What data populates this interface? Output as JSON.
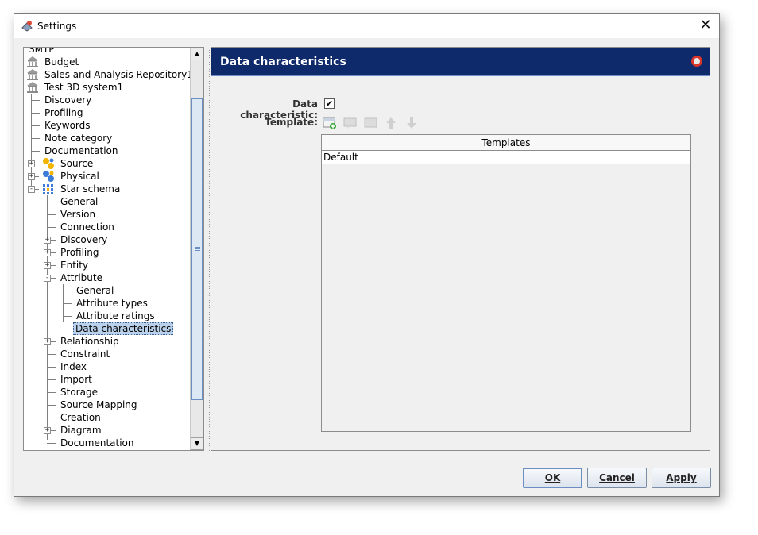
{
  "window": {
    "title": "Settings",
    "close_glyph": "✕"
  },
  "tree": {
    "items": [
      {
        "label": "SMTP"
      },
      {
        "label": "Budget",
        "icon": "bank-icon"
      },
      {
        "label": "Sales and Analysis Repository1",
        "icon": "bank-icon"
      },
      {
        "label": "Test 3D system1",
        "icon": "bank-icon"
      },
      {
        "label": "Discovery"
      },
      {
        "label": "Profiling"
      },
      {
        "label": "Keywords"
      },
      {
        "label": "Note category"
      },
      {
        "label": "Documentation"
      },
      {
        "label": "Source",
        "icon": "source-icon",
        "expander": "+"
      },
      {
        "label": "Physical",
        "icon": "physical-icon",
        "expander": "+"
      },
      {
        "label": "Star schema",
        "icon": "star-schema-icon",
        "expander": "-"
      },
      {
        "label": "General"
      },
      {
        "label": "Version"
      },
      {
        "label": "Connection"
      },
      {
        "label": "Discovery",
        "expander": "+"
      },
      {
        "label": "Profiling",
        "expander": "+"
      },
      {
        "label": "Entity",
        "expander": "+"
      },
      {
        "label": "Attribute",
        "expander": "-"
      },
      {
        "label": "General"
      },
      {
        "label": "Attribute types"
      },
      {
        "label": "Attribute ratings"
      },
      {
        "label": "Data characteristics",
        "selected": true
      },
      {
        "label": "Relationship",
        "expander": "+"
      },
      {
        "label": "Constraint"
      },
      {
        "label": "Index"
      },
      {
        "label": "Import"
      },
      {
        "label": "Storage"
      },
      {
        "label": "Source Mapping"
      },
      {
        "label": "Creation"
      },
      {
        "label": "Diagram",
        "expander": "+"
      },
      {
        "label": "Documentation"
      }
    ],
    "scroll_up": "▲",
    "scroll_down": "▼"
  },
  "panel": {
    "title": "Data characteristics",
    "data_characteristic_label": "Data characteristic:",
    "data_characteristic_checked": true,
    "check_glyph": "✔",
    "template_label": "Template:",
    "toolbar_icons": [
      "add-template-icon",
      "edit-template-icon",
      "delete-template-icon",
      "move-up-icon",
      "move-down-icon"
    ],
    "table": {
      "header": "Templates",
      "rows": [
        "Default"
      ]
    }
  },
  "buttons": {
    "ok": "OK",
    "cancel": "Cancel",
    "apply": "Apply"
  }
}
